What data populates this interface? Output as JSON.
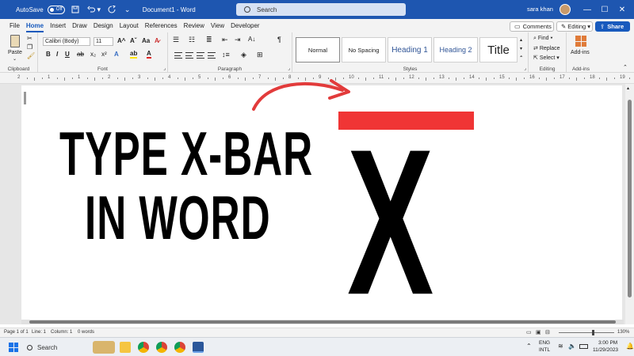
{
  "titlebar": {
    "autosave_label": "AutoSave",
    "autosave_state": "Off",
    "document_title": "Document1 - Word",
    "search_placeholder": "Search",
    "user_name": "sara khan"
  },
  "menu": {
    "tabs": [
      "File",
      "Home",
      "Insert",
      "Draw",
      "Design",
      "Layout",
      "References",
      "Review",
      "View",
      "Developer"
    ],
    "active_tab": "Home",
    "comments_label": "Comments",
    "editing_label": "Editing",
    "share_label": "Share"
  },
  "ribbon": {
    "paste_label": "Paste",
    "clipboard_label": "Clipboard",
    "font_name": "Calibri (Body)",
    "font_size": "11",
    "font_label": "Font",
    "paragraph_label": "Paragraph",
    "styles": [
      "Normal",
      "No Spacing",
      "Heading 1",
      "Heading 2",
      "Title"
    ],
    "styles_label": "Styles",
    "find_label": "Find",
    "replace_label": "Replace",
    "select_label": "Select",
    "editing_group_label": "Editing",
    "addins_label": "Add-ins",
    "addins_group_label": "Add-ins"
  },
  "ruler": {
    "numbers": [
      "2",
      "1",
      "1",
      "2",
      "3",
      "4",
      "5",
      "6",
      "7",
      "8",
      "9",
      "10",
      "11",
      "12",
      "13",
      "14",
      "15",
      "16",
      "17",
      "18",
      "19"
    ]
  },
  "document": {
    "line1": "TYPE X-BAR",
    "line2": "IN WORD",
    "symbol_letter": "X"
  },
  "statusbar": {
    "page": "Page 1 of 1",
    "line": "Line: 1",
    "column": "Column: 1",
    "words": "0 words",
    "zoom": "130%"
  },
  "taskbar": {
    "search_label": "Search",
    "language_top": "ENG",
    "language_bottom": "INTL",
    "time": "3:00 PM",
    "date": "11/29/2023"
  },
  "colors": {
    "accent": "#185abd",
    "titlebar": "#1e56b0",
    "bar_red": "#f03535"
  }
}
